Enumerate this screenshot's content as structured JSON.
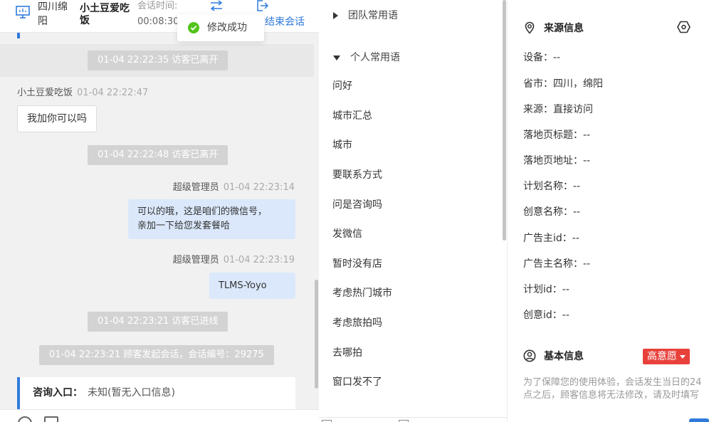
{
  "header": {
    "location": "四川绵阳",
    "visitor_name": "小土豆爱吃饭",
    "session_time_label": "会话时间:",
    "session_time_value": "00:08:30",
    "end_label": "结束会话"
  },
  "toast": {
    "message": "修改成功"
  },
  "chat": {
    "system_1": "01-04 22:22:35 访客已离开",
    "msg_1_sender": "小土豆爱吃饭",
    "msg_1_time": "01-04 22:22:47",
    "msg_1_text": "我加你可以吗",
    "system_2": "01-04 22:22:48 访客已离开",
    "msg_2_sender": "超级管理员",
    "msg_2_time": "01-04 22:23:14",
    "msg_2_line1": "可以的哦，这是咱们的微信号，",
    "msg_2_line2": "亲加一下给您发套餐哈",
    "msg_3_sender": "超级管理员",
    "msg_3_time": "01-04 22:23:19",
    "msg_3_text": "TLMS-Yoyo",
    "system_3": "01-04 22:23:21 访客已进线",
    "system_4": "01-04 22:23:21 顾客发起会话，会话编号：29275",
    "entry_label": "咨询入口：",
    "entry_value": "未知(暂无入口信息)"
  },
  "phrases": {
    "team_group": "团队常用语",
    "personal_group": "个人常用语",
    "items": [
      "问好",
      "城市汇总",
      "城市",
      "要联系方式",
      "问是咨询吗",
      "发微信",
      "暂时没有店",
      "考虑热门城市",
      "考虑旅拍吗",
      "去哪拍",
      "窗口发不了"
    ]
  },
  "info": {
    "source_title": "来源信息",
    "fields": [
      "设备：--",
      "省市：四川，绵阳",
      "来源：直接访问",
      "落地页标题：--",
      "落地页地址：--",
      "计划名称：--",
      "创意名称：--",
      "广告主id：--",
      "广告主名称：--",
      "计划id：--",
      "创意id：--"
    ],
    "basic_title": "基本信息",
    "intent_badge": "高意愿",
    "notice": "为了保障您的使用体验，会话发生当日的24点之后，顾客信息将无法修改，请及时填写"
  },
  "colors": {
    "accent": "#2f7bdc",
    "success": "#52c41a",
    "badge": "#e8413b",
    "outgoing_bubble": "#dbe8fb"
  },
  "icons": [
    "monitor-icon",
    "transfer-icon",
    "exit-icon",
    "success-check-icon",
    "location-pin-icon",
    "settings-hex-icon",
    "user-circle-icon",
    "emoji-icon",
    "file-icon"
  ]
}
